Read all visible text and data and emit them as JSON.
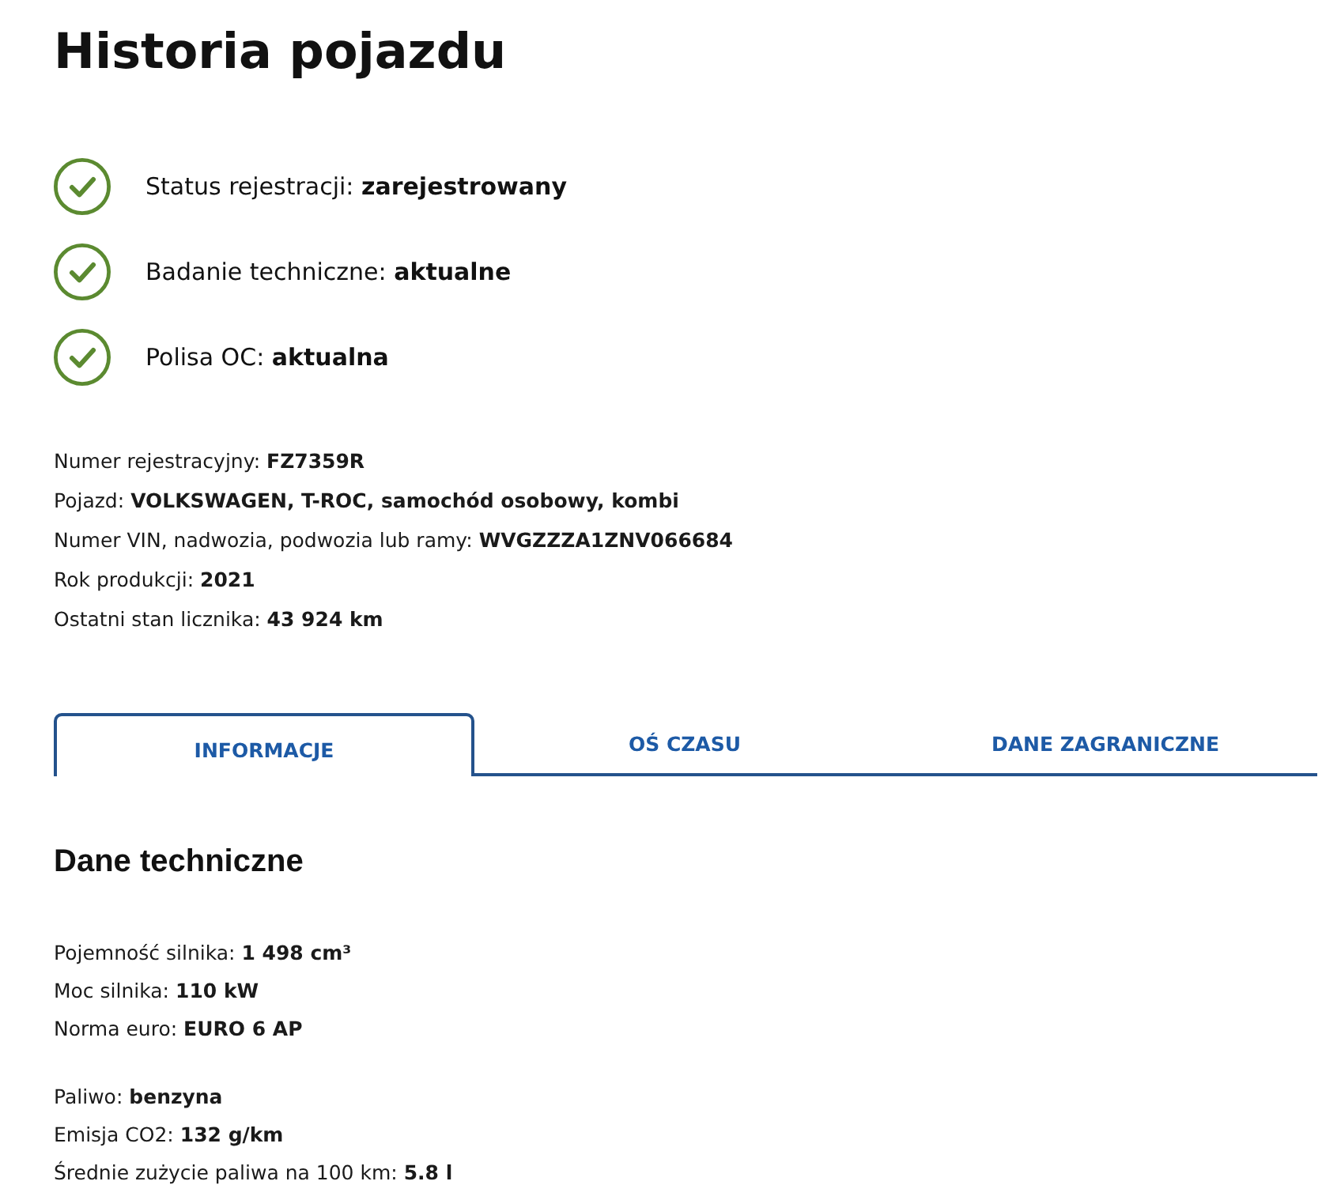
{
  "title": "Historia pojazdu",
  "statuses": [
    {
      "text": "Status rejestracji: **zarejestrowany**",
      "ok": true
    },
    {
      "text": "Badanie techniczne: **aktualne**",
      "ok": true
    },
    {
      "text": "Polisa OC: **aktualna**",
      "ok": true
    }
  ],
  "details": [
    "Numer rejestracyjny: **FZ7359R**",
    "Pojazd: **VOLKSWAGEN, T-ROC, samochód osobowy, kombi**",
    "Numer VIN, nadwozia, podwozia lub ramy: **WVGZZZA1ZNV066684**",
    "Rok produkcji: **2021**",
    "Ostatni stan licznika: **43 924 km**"
  ],
  "tabs": [
    {
      "label": "INFORMACJE",
      "selected": true
    },
    {
      "label": "OŚ CZASU",
      "selected": false
    },
    {
      "label": "DANE ZAGRANICZNE",
      "selected": false
    }
  ],
  "section": {
    "title": "Dane techniczne",
    "groups": [
      {
        "lines": [
          "Pojemność silnika: **1 498 cm³**",
          "Moc silnika: **110 kW**",
          "Norma euro: **EURO 6 AP**"
        ]
      },
      {
        "lines": [
          "Paliwo: **benzyna**",
          "Emisja CO2: **132 g/km**",
          "Średnie zużycie paliwa na 100 km: **5.8 l**"
        ]
      }
    ]
  }
}
